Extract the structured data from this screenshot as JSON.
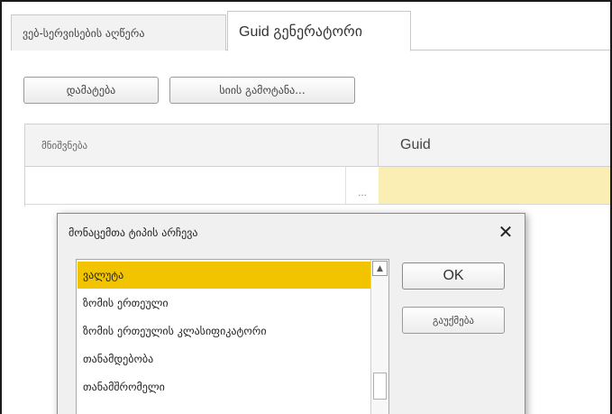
{
  "tabs": [
    {
      "label": "ვებ-სერვისების აღწერა",
      "active": false
    },
    {
      "label": "Guid გენერატორი",
      "active": true
    }
  ],
  "toolbar": {
    "add_label": "დამატება",
    "list_label": "სიის გამოტანა..."
  },
  "grid": {
    "columns": [
      "მნიშვნება",
      "Guid"
    ],
    "rows": [
      {
        "value": "",
        "select_label": "...",
        "guid": ""
      }
    ]
  },
  "dialog": {
    "title": "მონაცემთა ტიპის არჩევა",
    "close_icon": "close-icon",
    "items": [
      {
        "label": "ვალუტა",
        "selected": true
      },
      {
        "label": "ზომის ერთეული",
        "selected": false
      },
      {
        "label": "ზომის ერთეულის კლასიფიკატორი",
        "selected": false
      },
      {
        "label": "თანამდებობა",
        "selected": false
      },
      {
        "label": "თანამშრომელი",
        "selected": false
      }
    ],
    "ok_label": "OK",
    "cancel_label": "გაუქმება"
  },
  "colors": {
    "selection": "#f2c400",
    "guid_cell": "#fbeeb5"
  }
}
